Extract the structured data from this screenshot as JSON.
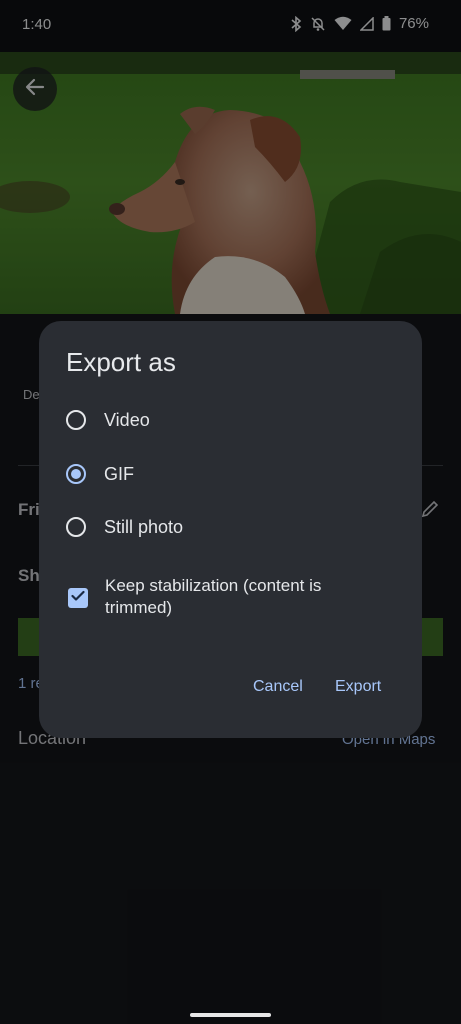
{
  "status_bar": {
    "time": "1:40",
    "battery_percent": "76%"
  },
  "background": {
    "partial_labels": [
      "De",
      "Fri",
      "Sh",
      "1 re"
    ],
    "location_label": "Location",
    "open_in_maps": "Open in Maps"
  },
  "dialog": {
    "title": "Export as",
    "options": [
      {
        "label": "Video",
        "selected": false
      },
      {
        "label": "GIF",
        "selected": true
      },
      {
        "label": "Still photo",
        "selected": false
      }
    ],
    "stabilization": {
      "label": "Keep stabilization (content is trimmed)",
      "checked": true
    },
    "cancel_label": "Cancel",
    "export_label": "Export"
  },
  "colors": {
    "accent": "#a8c7fa",
    "dialog_bg": "#2a2d33",
    "screen_bg": "#0f1114"
  }
}
